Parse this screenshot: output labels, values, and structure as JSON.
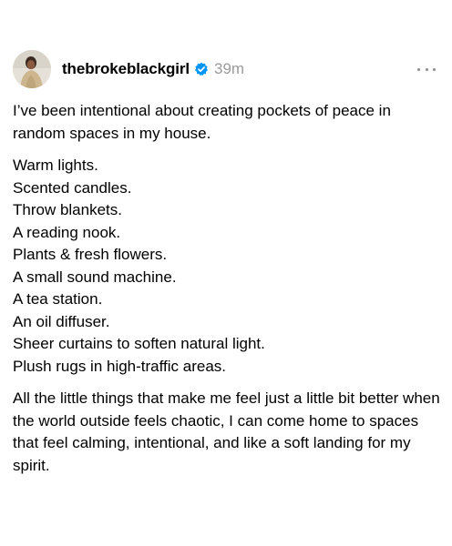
{
  "post": {
    "author": {
      "username": "thebrokeblackgirl",
      "verified_icon": "verified-badge-icon",
      "avatar_icon": "profile-avatar"
    },
    "timestamp": "39m",
    "more_icon": "more-options-icon",
    "intro": "I’ve been intentional about creating pockets of peace in random spaces in my house.",
    "items": [
      "Warm lights.",
      "Scented candles.",
      "Throw blankets.",
      "A reading nook.",
      "Plants & fresh flowers.",
      "A small sound machine.",
      "A tea station.",
      "An oil diffuser.",
      "Sheer curtains to soften natural light.",
      "Plush rugs in high-traffic areas."
    ],
    "outro": "All the little things that make me feel just a little bit better when the world outside feels chaotic, I can come home to spaces that feel calming, intentional, and like a soft landing for my spirit."
  },
  "colors": {
    "verified_blue": "#0095f6",
    "timestamp_gray": "#9a9a9a",
    "text": "#000000",
    "background": "#ffffff"
  }
}
